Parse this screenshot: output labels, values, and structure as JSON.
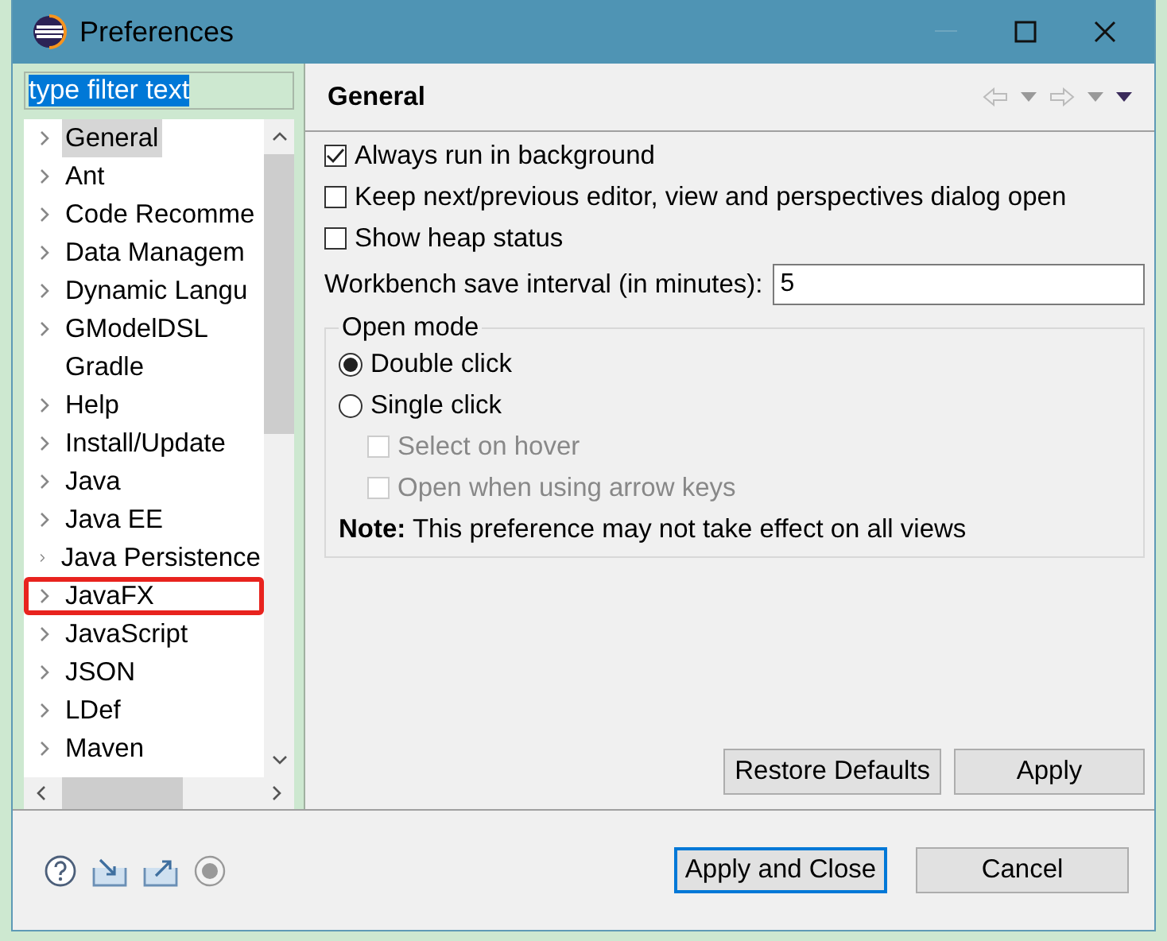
{
  "window": {
    "title": "Preferences"
  },
  "filter": {
    "value": "type filter text",
    "text_selected": true
  },
  "tree": [
    {
      "label": "General",
      "expandable": true,
      "selected": true,
      "highlighted": false
    },
    {
      "label": "Ant",
      "expandable": true,
      "selected": false,
      "highlighted": false
    },
    {
      "label": "Code Recomme",
      "expandable": true,
      "selected": false,
      "highlighted": false
    },
    {
      "label": "Data Managem",
      "expandable": true,
      "selected": false,
      "highlighted": false
    },
    {
      "label": "Dynamic Langu",
      "expandable": true,
      "selected": false,
      "highlighted": false
    },
    {
      "label": "GModelDSL",
      "expandable": true,
      "selected": false,
      "highlighted": false
    },
    {
      "label": "Gradle",
      "expandable": false,
      "selected": false,
      "highlighted": false
    },
    {
      "label": "Help",
      "expandable": true,
      "selected": false,
      "highlighted": false
    },
    {
      "label": "Install/Update",
      "expandable": true,
      "selected": false,
      "highlighted": false
    },
    {
      "label": "Java",
      "expandable": true,
      "selected": false,
      "highlighted": false
    },
    {
      "label": "Java EE",
      "expandable": true,
      "selected": false,
      "highlighted": false
    },
    {
      "label": "Java Persistence",
      "expandable": true,
      "selected": false,
      "highlighted": false
    },
    {
      "label": "JavaFX",
      "expandable": true,
      "selected": false,
      "highlighted": true
    },
    {
      "label": "JavaScript",
      "expandable": true,
      "selected": false,
      "highlighted": false
    },
    {
      "label": "JSON",
      "expandable": true,
      "selected": false,
      "highlighted": false
    },
    {
      "label": "LDef",
      "expandable": true,
      "selected": false,
      "highlighted": false
    },
    {
      "label": "Maven",
      "expandable": true,
      "selected": false,
      "highlighted": false
    }
  ],
  "page": {
    "title": "General",
    "options": [
      {
        "label": "Always run in background",
        "checked": true
      },
      {
        "label": "Keep next/previous editor, view and perspectives dialog open",
        "checked": false
      },
      {
        "label": "Show heap status",
        "checked": false
      }
    ],
    "save_interval": {
      "label": "Workbench save interval (in minutes):",
      "value": "5"
    },
    "open_mode": {
      "title": "Open mode",
      "choices": [
        {
          "label": "Double click",
          "selected": true
        },
        {
          "label": "Single click",
          "selected": false
        }
      ],
      "sub_options": [
        {
          "label": "Select on hover",
          "checked": false,
          "disabled": true
        },
        {
          "label": "Open when using arrow keys",
          "checked": false,
          "disabled": true
        }
      ],
      "note": "**Note:** This preference may not take effect on all views"
    },
    "buttons": [
      "Restore Defaults",
      "Apply"
    ]
  },
  "footer_buttons": [
    {
      "label": "Apply and Close",
      "default": true
    },
    {
      "label": "Cancel",
      "default": false
    }
  ]
}
